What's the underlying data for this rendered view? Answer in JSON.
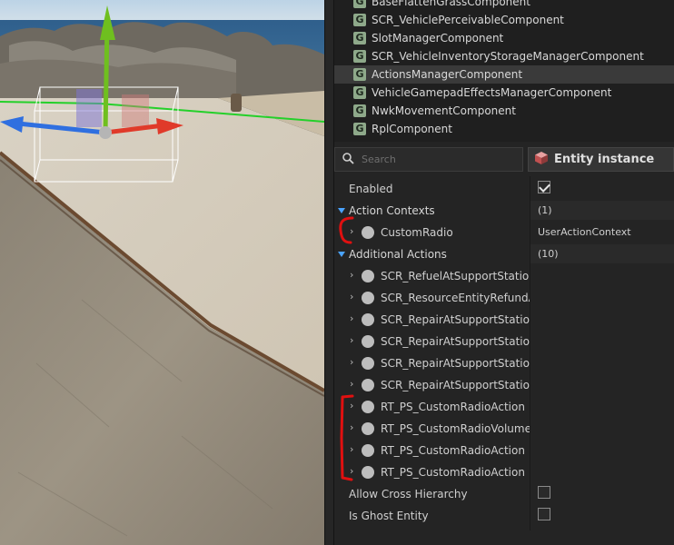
{
  "components": [
    {
      "icon": "G",
      "label": "BaseFlattenGrassComponent",
      "selected": false
    },
    {
      "icon": "G",
      "label": "SCR_VehiclePerceivableComponent",
      "selected": false
    },
    {
      "icon": "G",
      "label": "SlotManagerComponent",
      "selected": false
    },
    {
      "icon": "G",
      "label": "SCR_VehicleInventoryStorageManagerComponent",
      "selected": false
    },
    {
      "icon": "G",
      "label": "ActionsManagerComponent",
      "selected": true
    },
    {
      "icon": "G",
      "label": "VehicleGamepadEffectsManagerComponent",
      "selected": false
    },
    {
      "icon": "G",
      "label": "NwkMovementComponent",
      "selected": false
    },
    {
      "icon": "G",
      "label": "RplComponent",
      "selected": false
    }
  ],
  "toolbar": {
    "search_placeholder": "Search",
    "entity_label": "Entity instance"
  },
  "properties": {
    "enabled_label": "Enabled",
    "enabled_checked": true,
    "action_contexts": {
      "label": "Action Contexts",
      "count": "(1)",
      "items": [
        {
          "label": "CustomRadio",
          "value": "UserActionContext"
        }
      ]
    },
    "additional_actions": {
      "label": "Additional Actions",
      "count": "(10)",
      "items": [
        {
          "label": "SCR_RefuelAtSupportStationAc"
        },
        {
          "label": "SCR_ResourceEntityRefundActi"
        },
        {
          "label": "SCR_RepairAtSupportStationAc"
        },
        {
          "label": "SCR_RepairAtSupportStationAc"
        },
        {
          "label": "SCR_RepairAtSupportStationAc"
        },
        {
          "label": "SCR_RepairAtSupportStationAc"
        },
        {
          "label": "RT_PS_CustomRadioAction"
        },
        {
          "label": "RT_PS_CustomRadioVolumeAct"
        },
        {
          "label": "RT_PS_CustomRadioAction"
        },
        {
          "label": "RT_PS_CustomRadioAction"
        }
      ]
    },
    "allow_cross_hierarchy_label": "Allow Cross Hierarchy",
    "allow_cross_hierarchy_checked": false,
    "is_ghost_entity_label": "Is Ghost Entity",
    "is_ghost_entity_checked": false
  },
  "colors": {
    "accent": "#4aa3ff",
    "gizmo_x": "#e03a2a",
    "gizmo_y": "#6fbf1f",
    "gizmo_z": "#2f6fe0",
    "annotation": "#e01010"
  }
}
